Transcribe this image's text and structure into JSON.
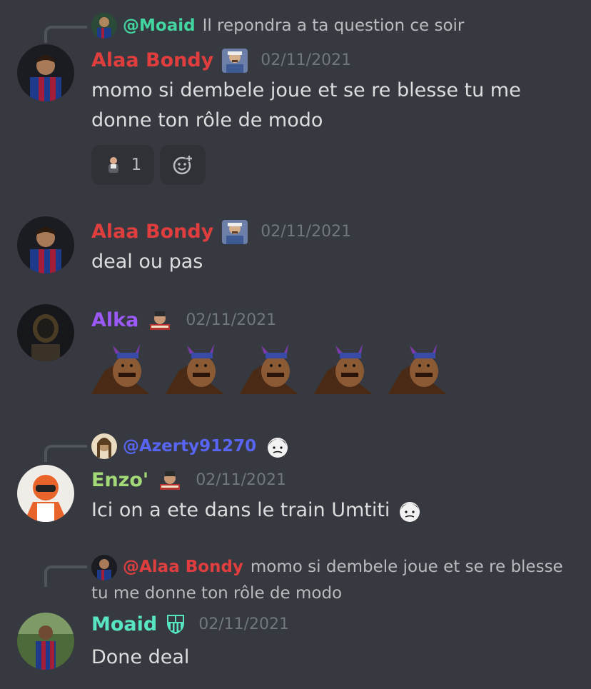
{
  "colors": {
    "background": "#36393f",
    "alaa": "#e03e3e",
    "alka": "#9b59f6",
    "enzo": "#a3d977",
    "moaid": "#58e6c2",
    "azerty": "#5865f2",
    "moaid_mention": "#43d6a0"
  },
  "messages": [
    {
      "reply_to": {
        "name": "@Moaid",
        "text": "Il repondra a ta question ce soir"
      },
      "author": "Alaa Bondy",
      "timestamp": "02/11/2021",
      "text": "momo si dembele joue et se re blesse tu me donne ton rôle de modo",
      "reactions": [
        {
          "icon": "man-emoji",
          "count": "1"
        }
      ]
    },
    {
      "author": "Alaa Bondy",
      "timestamp": "02/11/2021",
      "text": "deal ou pas"
    },
    {
      "author": "Alka",
      "timestamp": "02/11/2021",
      "text": "",
      "emote_count": 5,
      "emote": "horned-man-emote"
    },
    {
      "reply_to": {
        "name": "@Azerty91270",
        "text": ""
      },
      "author": "Enzo'",
      "timestamp": "02/11/2021",
      "text": "Ici on a ete dans le train Umtiti"
    },
    {
      "reply_to": {
        "name": "@Alaa Bondy",
        "text": "momo si dembele joue et se re blesse tu me donne ton rôle de modo"
      },
      "author": "Moaid",
      "timestamp": "02/11/2021",
      "text": "Done deal"
    }
  ]
}
